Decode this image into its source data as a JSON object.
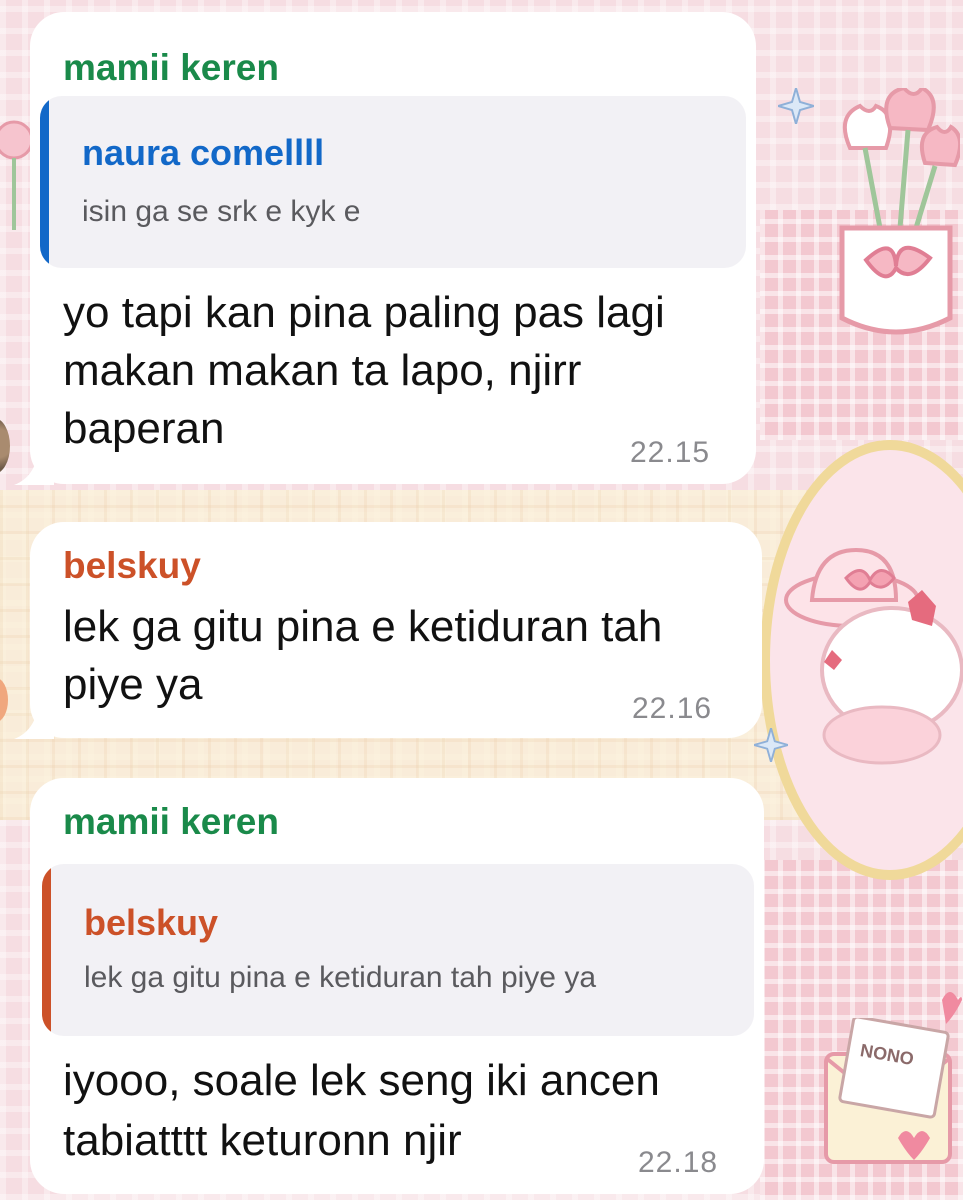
{
  "colors": {
    "green_sender": "#1a8a4a",
    "blue_sender": "#1268c8",
    "orange_sender": "#cc5128",
    "bubble_bg": "#ffffff",
    "quote_bg": "#f2f1f5",
    "timestamp": "#8a8a8e"
  },
  "messages": [
    {
      "sender": "mamii keren",
      "reply": {
        "name": "naura comellll",
        "text": "isin ga se srk e kyk e"
      },
      "lines": [
        "yo tapi kan pina paling pas lagi",
        "makan makan ta lapo, njirr",
        "baperan"
      ],
      "time": "22.15"
    },
    {
      "sender": "belskuy",
      "lines": [
        "lek ga gitu pina e ketiduran tah",
        "piye ya"
      ],
      "time": "22.16"
    },
    {
      "sender": "mamii keren",
      "reply": {
        "name": "belskuy",
        "text": "lek ga gitu pina e ketiduran tah piye ya"
      },
      "lines": [
        "iyooo, soale lek seng iki ancen",
        "tabiatttt keturonn njir"
      ],
      "time": "22.18"
    }
  ],
  "wallpaper": {
    "decorations": [
      "tulip-pot-icon",
      "sparkle-icon",
      "bunny-with-hat-icon",
      "letter-icon",
      "heart-icon",
      "flower-icon"
    ],
    "letter_text": "NONO"
  }
}
